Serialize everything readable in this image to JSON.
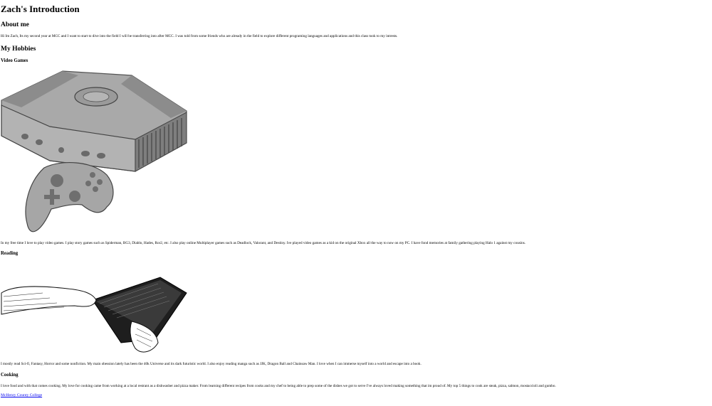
{
  "page": {
    "title": "Zach's Introduction",
    "about_heading": "About me",
    "about_text": "Hi Im Zach, Its my second year at MCC and I want to start to dive into the field I will be transferring into after MCC. I was told from some friends who are already in the field to explore different programing languages and applications and this class took to my intrests.",
    "hobbies_heading": "My Hobbies"
  },
  "hobbies": {
    "video_games": {
      "heading": "Video Games",
      "image_icon": "xbox-console-controller-illustration",
      "text": "In my free time I love to play video games. I play story games such as Spiderman, BG3, Diablo, Hades, Ror2, etc. I also play online Multiplayer games such as Deadlock, Valorant, and Destiny. Ive played video games as a kid on the original Xbox all the way to now on my PC. I have fond memories at family gathering playing Halo 1 against my cousins."
    },
    "reading": {
      "heading": "Reading",
      "image_icon": "hands-holding-book-engraving",
      "text": "I mostly read Sci-fi, Fantasy, Horror and some nonfiction. My main obession lately has been the 40k Universe and its dark futuristic world. I also enjoy reading manga such as JJK, Dragon Ball and Chainsaw Man. I love when I can immerse myself into a world and escape into a book."
    },
    "cooking": {
      "heading": "Cooking",
      "text": "I love food and with that comes cooking. My love for cooking came from working at a local restrant as a dishwasher and pizza maker. From learning different recipes from cooks and my chef to being able to prep some of the dishes we got to serve I've always loved making something that im proud of. My top 5 things to cook are steak, pizza, salmon, mostaccioli and gumbo."
    }
  },
  "footer": {
    "link_text": "McHenry County College"
  },
  "colors": {
    "link": "#0000ee",
    "console_gray": "#a6a6a6"
  }
}
